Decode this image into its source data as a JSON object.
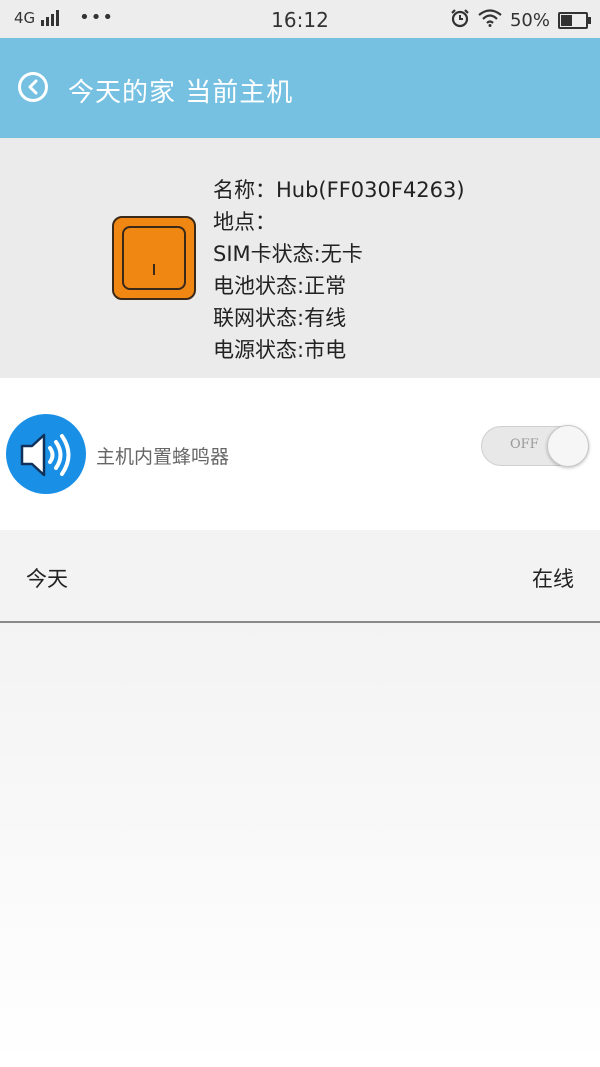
{
  "status_bar": {
    "network": "4G",
    "dots": "•••",
    "time": "16:12",
    "battery_percent": "50%"
  },
  "header": {
    "title": "今天的家 当前主机",
    "background_color": "#76c1e2"
  },
  "device": {
    "name_line": "名称：Hub(FF030F4263)",
    "location_line": "地点：",
    "sim_line": "SIM卡状态:无卡",
    "battery_line": "电池状态:正常",
    "network_line": "联网状态:有线",
    "power_line": "电源状态:市电",
    "icon_color": "#f08713"
  },
  "buzzer": {
    "label": "主机内置蜂鸣器",
    "toggle_text": "OFF",
    "toggle_on": false,
    "icon_color": "#1a8fe6"
  },
  "status_row": {
    "name": "今天",
    "state": "在线"
  }
}
